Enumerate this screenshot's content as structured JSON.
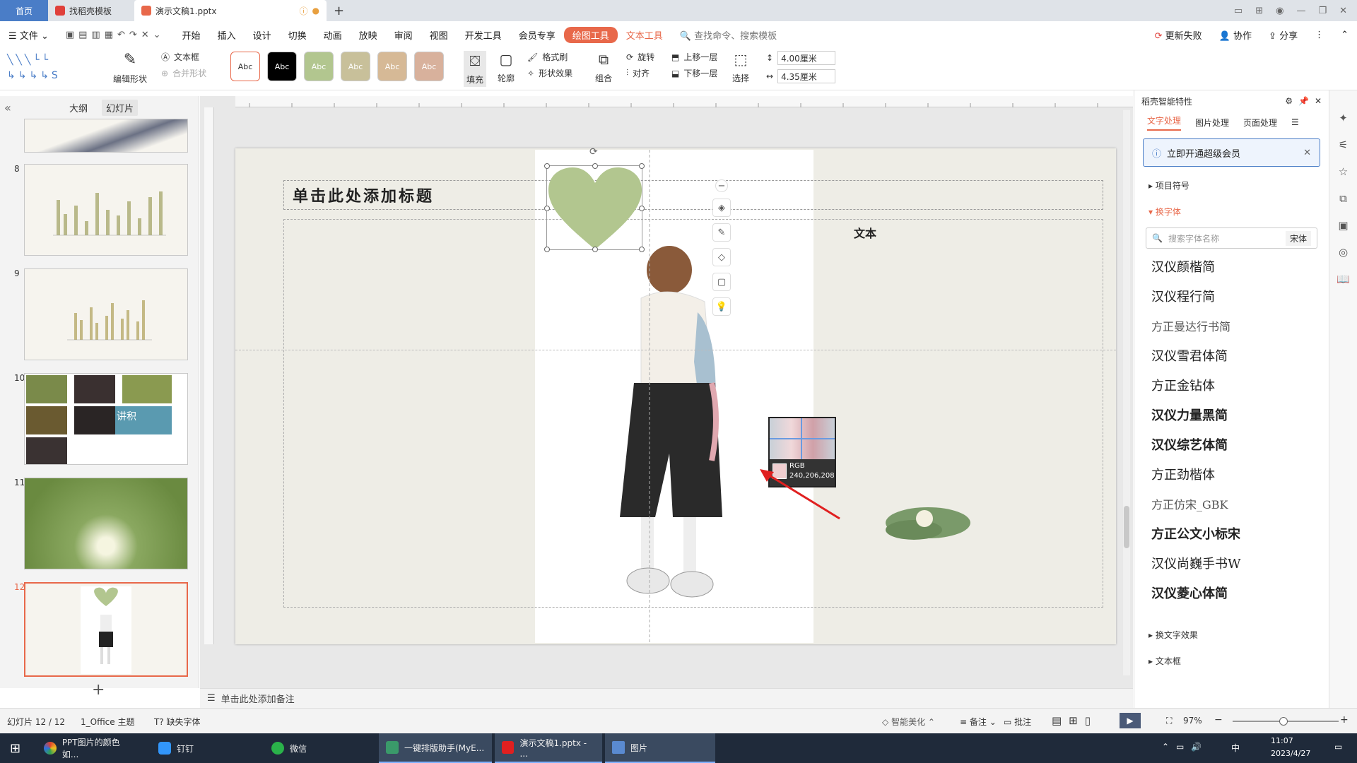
{
  "tabs": {
    "home": "首页",
    "template": "找稻壳模板",
    "doc": "演示文稿1.pptx"
  },
  "menu": {
    "file": "文件",
    "items": [
      "开始",
      "插入",
      "设计",
      "切换",
      "动画",
      "放映",
      "审阅",
      "视图",
      "开发工具",
      "会员专享"
    ],
    "drawing_tools": "绘图工具",
    "text_tools": "文本工具",
    "search": "查找命令、搜索模板",
    "update": "更新失败",
    "collab": "协作",
    "share": "分享"
  },
  "ribbon": {
    "edit_shape": "编辑形状",
    "textbox": "文本框",
    "merge_shape": "合并形状",
    "style_label": "Abc",
    "fill": "填充",
    "outline": "轮廓",
    "format_painter": "格式刷",
    "shape_effect": "形状效果",
    "group": "组合",
    "rotate": "旋转",
    "align": "对齐",
    "bring_forward": "上移一层",
    "send_backward": "下移一层",
    "select": "选择",
    "height": "4.00厘米",
    "width": "4.35厘米"
  },
  "left_panel": {
    "tab_outline": "大纲",
    "tab_slides": "幻灯片",
    "slides": [
      "8",
      "9",
      "10",
      "11",
      "12"
    ],
    "thumb_text_10": "讲积"
  },
  "slide": {
    "title_placeholder": "单击此处添加标题",
    "content_partial": "文本"
  },
  "picker": {
    "label": "RGB",
    "value": "240,206,208",
    "color": "#f0ced0"
  },
  "notes": {
    "placeholder": "单击此处添加备注"
  },
  "right_panel": {
    "header": "稻壳智能特性",
    "tabs": [
      "文字处理",
      "图片处理",
      "页面处理"
    ],
    "vip": "立即开通超级会员",
    "bullets": "项目符号",
    "change_font": "换字体",
    "font_search_placeholder": "搜索字体名称",
    "font_current": "宋体",
    "fonts": [
      "汉仪颜楷简",
      "汉仪程行简",
      "方正曼达行书简",
      "汉仪雪君体简",
      "方正金钻体",
      "汉仪力量黑简",
      "汉仪综艺体简",
      "方正劲楷体",
      "方正仿宋_GBK",
      "方正公文小标宋",
      "汉仪尚巍手书W",
      "汉仪菱心体简"
    ],
    "text_effect": "换文字效果",
    "textbox": "文本框"
  },
  "status": {
    "slide_count": "幻灯片 12 / 12",
    "theme": "1_Office 主题",
    "missing_font": "缺失字体",
    "smart": "智能美化",
    "notes": "备注",
    "comments": "批注",
    "zoom": "97%"
  },
  "taskbar": {
    "items": [
      "PPT图片的颜色如...",
      "钉钉",
      "微信",
      "一键排版助手(MyE...",
      "演示文稿1.pptx - ...",
      "图片"
    ],
    "time": "11:07",
    "date": "2023/4/27",
    "ime": "中"
  },
  "colors": {
    "accent": "#e8684a",
    "heart": "#b2c68f",
    "slide_bg": "#eeede6"
  }
}
